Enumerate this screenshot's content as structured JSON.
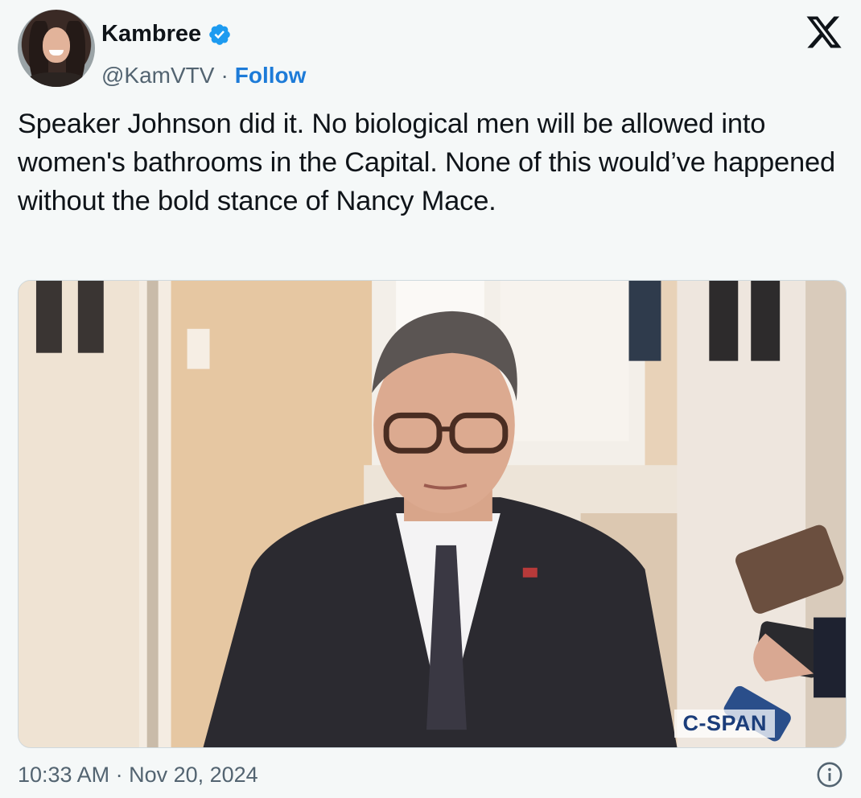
{
  "author": {
    "name": "Kambree",
    "handle": "@KamVTV",
    "separator": "·",
    "follow_label": "Follow",
    "avatar_icon": "profile-photo",
    "verified_icon": "verified-badge-icon",
    "verified_color": "#1d9bf0"
  },
  "platform_icon": "x-logo-icon",
  "tweet": {
    "text": "Speaker Johnson did it. No biological men will be allowed into women's bathrooms in the Capital. None of this would’ve happened without the bold stance of Nancy Mace."
  },
  "media": {
    "watermark": "C-SPAN"
  },
  "footer": {
    "timestamp": "10:33 AM · Nov 20, 2024",
    "info_icon": "info-circle-icon"
  },
  "colors": {
    "follow": "#1d7bd8",
    "secondary_text": "#536471",
    "background": "#f5f8f8"
  }
}
